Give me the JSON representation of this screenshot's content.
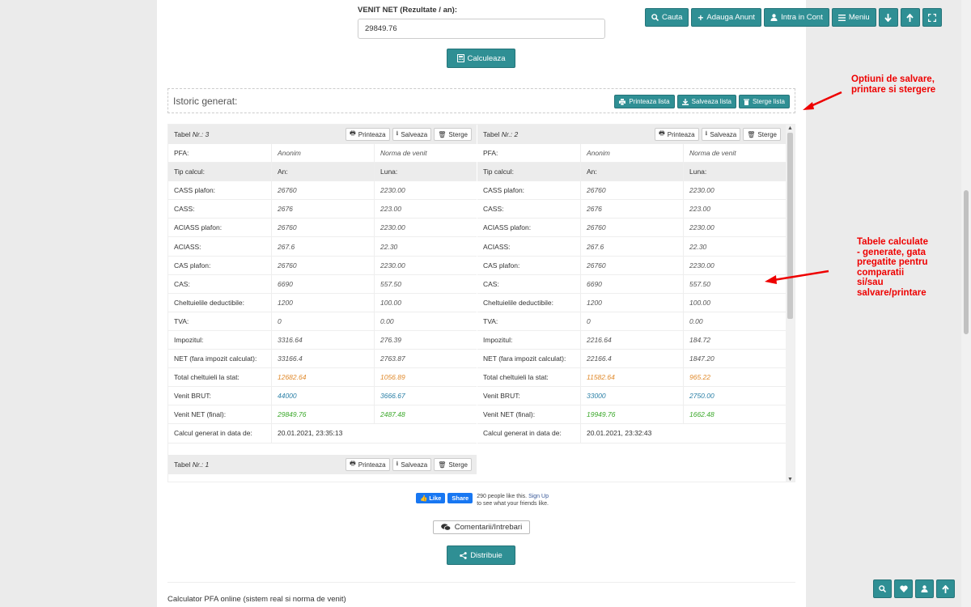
{
  "form": {
    "venit_label": "VENIT NET (Rezultate / an):",
    "venit_value": "29849.76",
    "calc_label": "Calculeaza"
  },
  "topnav": {
    "cauta": "Cauta",
    "adauga": "Adauga Anunt",
    "intra": "Intra in Cont",
    "meniu": "Meniu"
  },
  "istoric": {
    "title": "Istoric generat:",
    "print_list": "Printeaza lista",
    "save_list": "Salveaza lista",
    "delete_list": "Sterge lista"
  },
  "table_buttons": {
    "print": "Printeaza",
    "save": "Salveaza",
    "delete": "Sterge"
  },
  "tables": [
    {
      "label": "Tabel",
      "nr": "Nr.: 3",
      "rows": [
        [
          "PFA:",
          "Anonim",
          "Norma de venit"
        ],
        [
          "Tip calcul:",
          "An:",
          "Luna:"
        ],
        [
          "CASS plafon:",
          "26760",
          "2230.00"
        ],
        [
          "CASS:",
          "2676",
          "223.00"
        ],
        [
          "ACIASS plafon:",
          "26760",
          "2230.00"
        ],
        [
          "ACIASS:",
          "267.6",
          "22.30"
        ],
        [
          "CAS plafon:",
          "26760",
          "2230.00"
        ],
        [
          "CAS:",
          "6690",
          "557.50"
        ],
        [
          "Cheltuielile deductibile:",
          "1200",
          "100.00"
        ],
        [
          "TVA:",
          "0",
          "0.00"
        ],
        [
          "Impozitul:",
          "3316.64",
          "276.39"
        ],
        [
          "NET (fara impozit calculat):",
          "33166.4",
          "2763.87"
        ],
        [
          "Total cheltuieli la stat:",
          "12682.64",
          "1056.89"
        ],
        [
          "Venit BRUT:",
          "44000",
          "3666.67"
        ],
        [
          "Venit NET (final):",
          "29849.76",
          "2487.48"
        ],
        [
          "Calcul generat in data de:",
          "20.01.2021, 23:35:13",
          ""
        ]
      ]
    },
    {
      "label": "Tabel",
      "nr": "Nr.: 2",
      "rows": [
        [
          "PFA:",
          "Anonim",
          "Norma de venit"
        ],
        [
          "Tip calcul:",
          "An:",
          "Luna:"
        ],
        [
          "CASS plafon:",
          "26760",
          "2230.00"
        ],
        [
          "CASS:",
          "2676",
          "223.00"
        ],
        [
          "ACIASS plafon:",
          "26760",
          "2230.00"
        ],
        [
          "ACIASS:",
          "267.6",
          "22.30"
        ],
        [
          "CAS plafon:",
          "26760",
          "2230.00"
        ],
        [
          "CAS:",
          "6690",
          "557.50"
        ],
        [
          "Cheltuielile deductibile:",
          "1200",
          "100.00"
        ],
        [
          "TVA:",
          "0",
          "0.00"
        ],
        [
          "Impozitul:",
          "2216.64",
          "184.72"
        ],
        [
          "NET (fara impozit calculat):",
          "22166.4",
          "1847.20"
        ],
        [
          "Total cheltuieli la stat:",
          "11582.64",
          "965.22"
        ],
        [
          "Venit BRUT:",
          "33000",
          "2750.00"
        ],
        [
          "Venit NET (final):",
          "19949.76",
          "1662.48"
        ],
        [
          "Calcul generat in data de:",
          "20.01.2021, 23:32:43",
          ""
        ]
      ]
    },
    {
      "label": "Tabel",
      "nr": "Nr.: 1"
    }
  ],
  "facebook": {
    "like": "Like",
    "share": "Share",
    "count_text": "290 people like this.",
    "signup": "Sign Up",
    "rest": "to see what your friends like."
  },
  "comentarii": "Comentarii/Intrebari",
  "distribuie": "Distribuie",
  "footer_title": "Calculator PFA online (sistem real si norma de venit)",
  "annotations": {
    "a1_line1": "Optiuni de salvare,",
    "a1_line2": "printare si stergere",
    "a2_line1": "Tabele calculate",
    "a2_line2": "- generate, gata",
    "a2_line3": "pregatite pentru",
    "a2_line4": "comparatii",
    "a2_line5": "si/sau",
    "a2_line6": "salvare/printare"
  },
  "colors": {
    "teal": "#2f8f94",
    "annotation_red": "#e00000",
    "orange": "#e08a2c",
    "blue": "#2a7fa6",
    "green": "#3aa829"
  }
}
